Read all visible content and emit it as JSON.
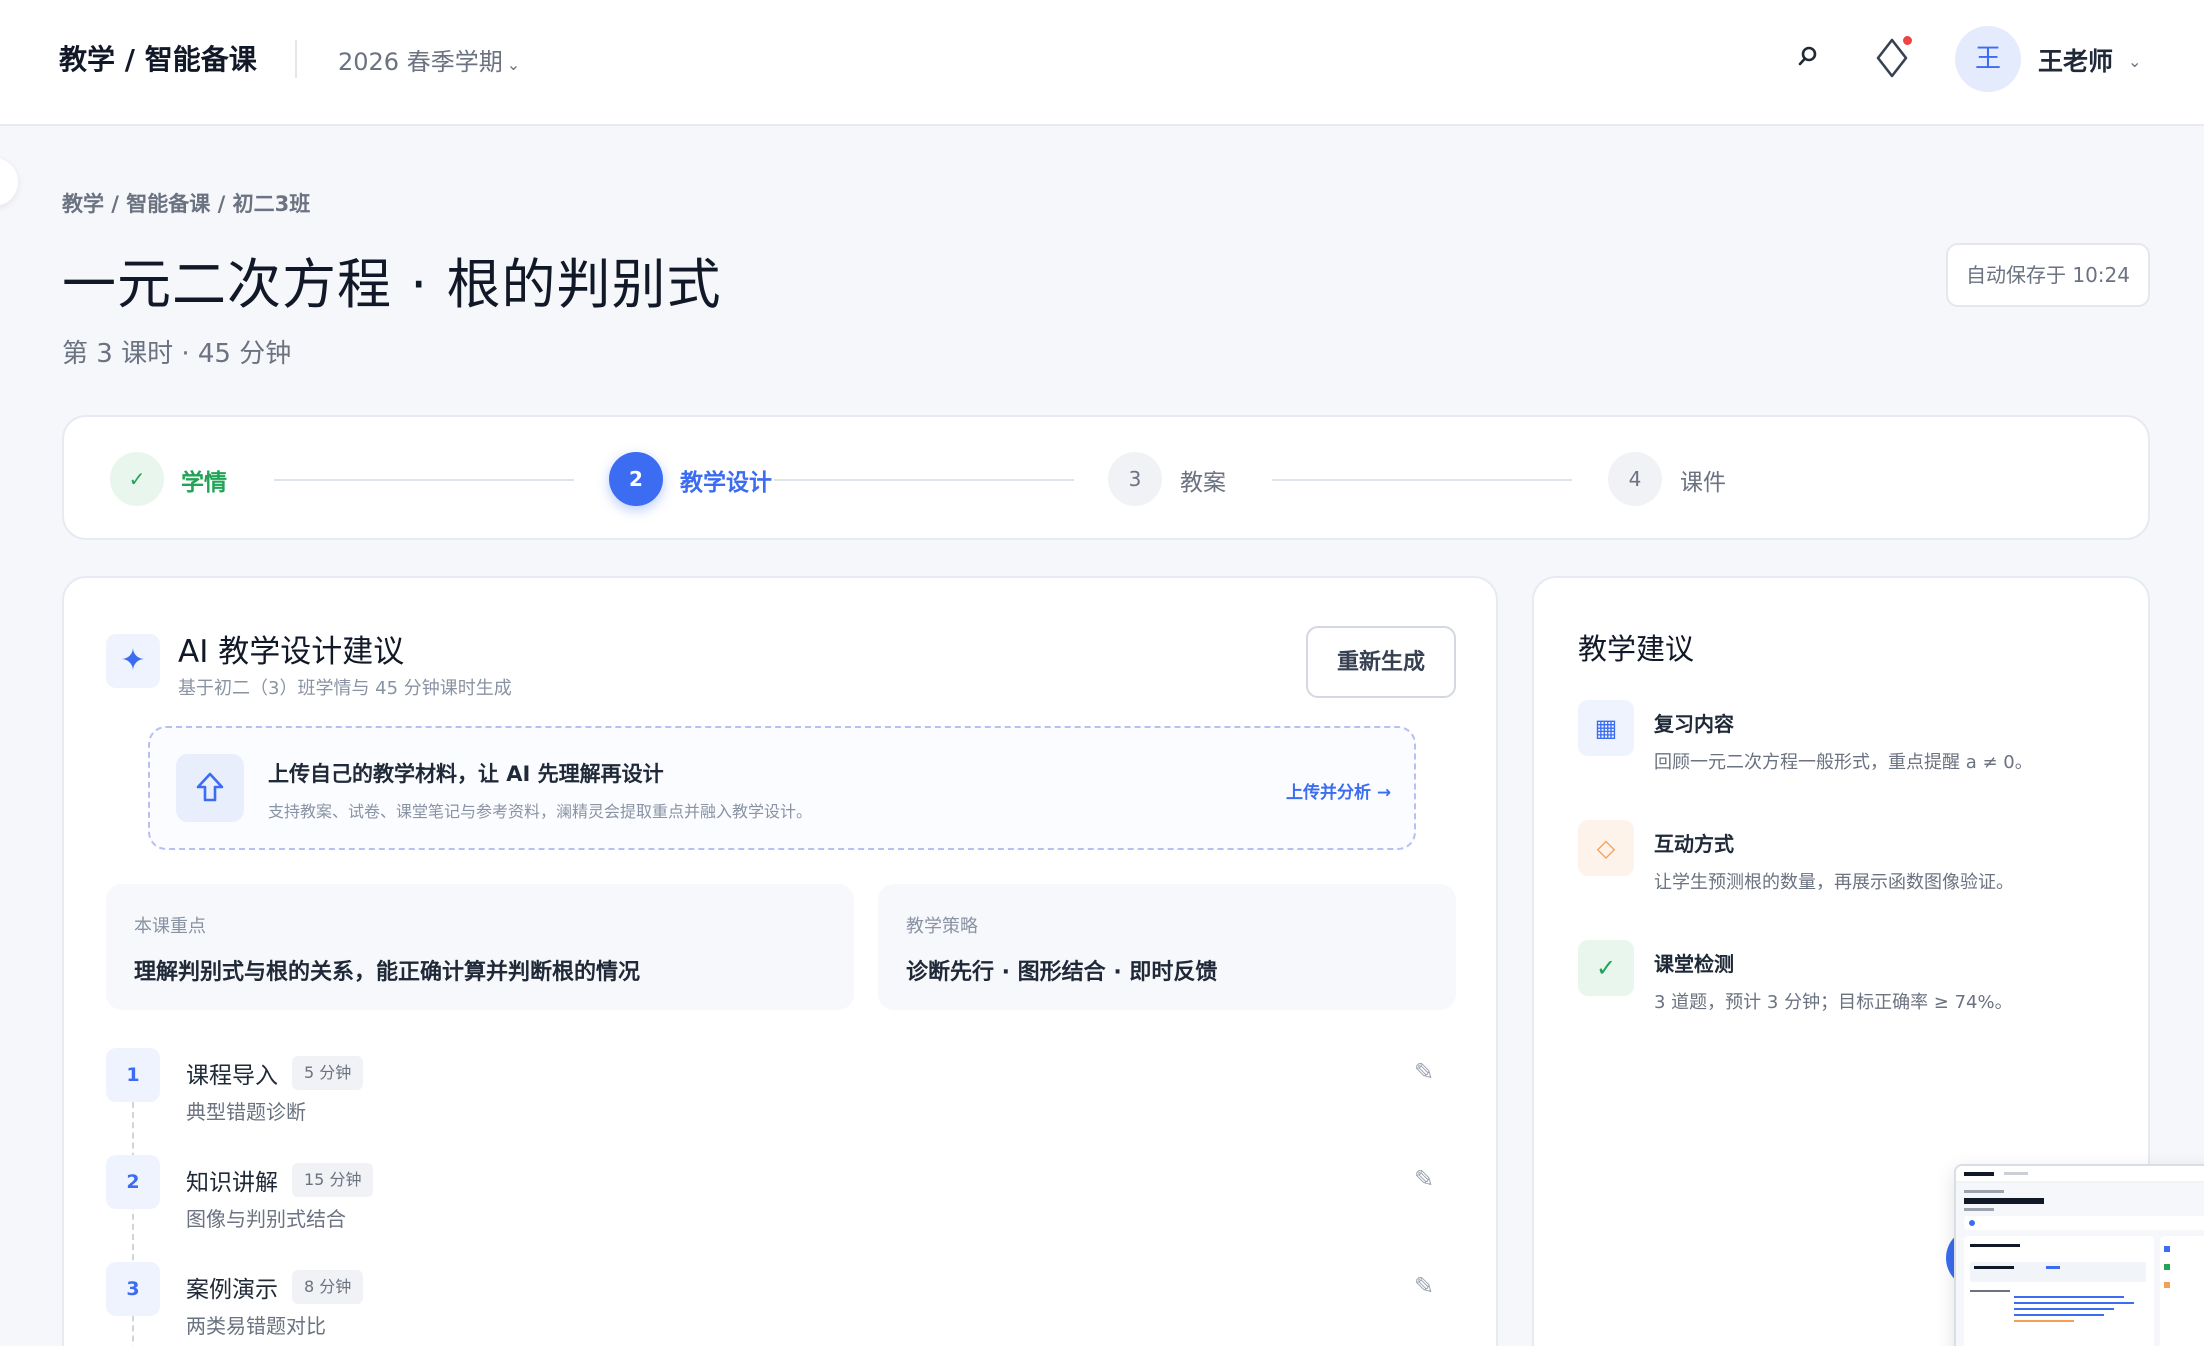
{
  "topbar": {
    "brand": "教学 / 智能备课",
    "term": "2026 春季学期",
    "term_chev": "⌄",
    "user_avatar": "王",
    "user_name": "王老师",
    "user_chev": "⌄"
  },
  "header": {
    "breadcrumb": "教学 / 智能备课 / 初二3班",
    "title": "一元二次方程 · 根的判别式",
    "subtitle": "第 3 课时 · 45 分钟",
    "autosave": "自动保存于 10:24"
  },
  "stepper": [
    {
      "num": "✓",
      "label": "学情",
      "state": "done"
    },
    {
      "num": "2",
      "label": "教学设计",
      "state": "active"
    },
    {
      "num": "3",
      "label": "教案",
      "state": "todo"
    },
    {
      "num": "4",
      "label": "课件",
      "state": "todo"
    }
  ],
  "ai_design": {
    "icon": "✦",
    "title": "AI 教学设计建议",
    "subtitle": "基于初二（3）班学情与 45 分钟课时生成",
    "regen_label": "重新生成",
    "upload": {
      "title": "上传自己的教学材料，让 AI 先理解再设计",
      "desc": "支持教案、试卷、课堂笔记与参考资料，澜精灵会提取重点并融入教学设计。",
      "link": "上传并分析 →"
    },
    "focus": {
      "caption": "本课重点",
      "value": "理解判别式与根的关系，能正确计算并判断根的情况"
    },
    "strategy": {
      "caption": "教学策略",
      "value": "诊断先行 · 图形结合 · 即时反馈"
    },
    "lessons": [
      {
        "num": "1",
        "title": "课程导入",
        "duration": "5 分钟",
        "desc": "典型错题诊断"
      },
      {
        "num": "2",
        "title": "知识讲解",
        "duration": "15 分钟",
        "desc": "图像与判别式结合"
      },
      {
        "num": "3",
        "title": "案例演示",
        "duration": "8 分钟",
        "desc": "两类易错题对比"
      }
    ],
    "edit_glyph": "✎"
  },
  "suggestions": {
    "title": "教学建议",
    "items": [
      {
        "icon": "▦",
        "title": "复习内容",
        "desc": "回顾一元二次方程一般形式，重点提醒 a ≠ 0。"
      },
      {
        "icon": "◇",
        "title": "互动方式",
        "desc": "让学生预测根的数量，再展示函数图像验证。"
      },
      {
        "icon": "✓",
        "title": "课堂检测",
        "desc": "3 道题，预计 3 分钟；目标正确率 ≥ 74%。"
      }
    ]
  },
  "colors": {
    "primary": "#3b6cf2",
    "success": "#22a356",
    "warning": "#f59e54",
    "badge_dot": "#ef4444"
  }
}
